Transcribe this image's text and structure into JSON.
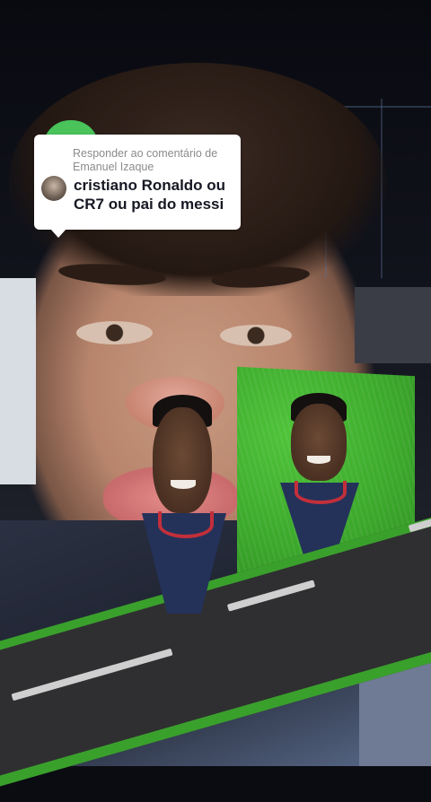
{
  "comment_reply": {
    "reply_prefix": "Responder ao comentário de",
    "commenter_name": "Emanuel Izaque",
    "comment_text": "cristiano Ronaldo ou CR7 ou pai do messi"
  },
  "colors": {
    "bubble_background": "#ffffff",
    "reply_text": "#8b8b8b",
    "comment_text": "#161823",
    "accent_green": "#49c35a",
    "grass": "#3aa52a",
    "road": "#2f2f31"
  }
}
